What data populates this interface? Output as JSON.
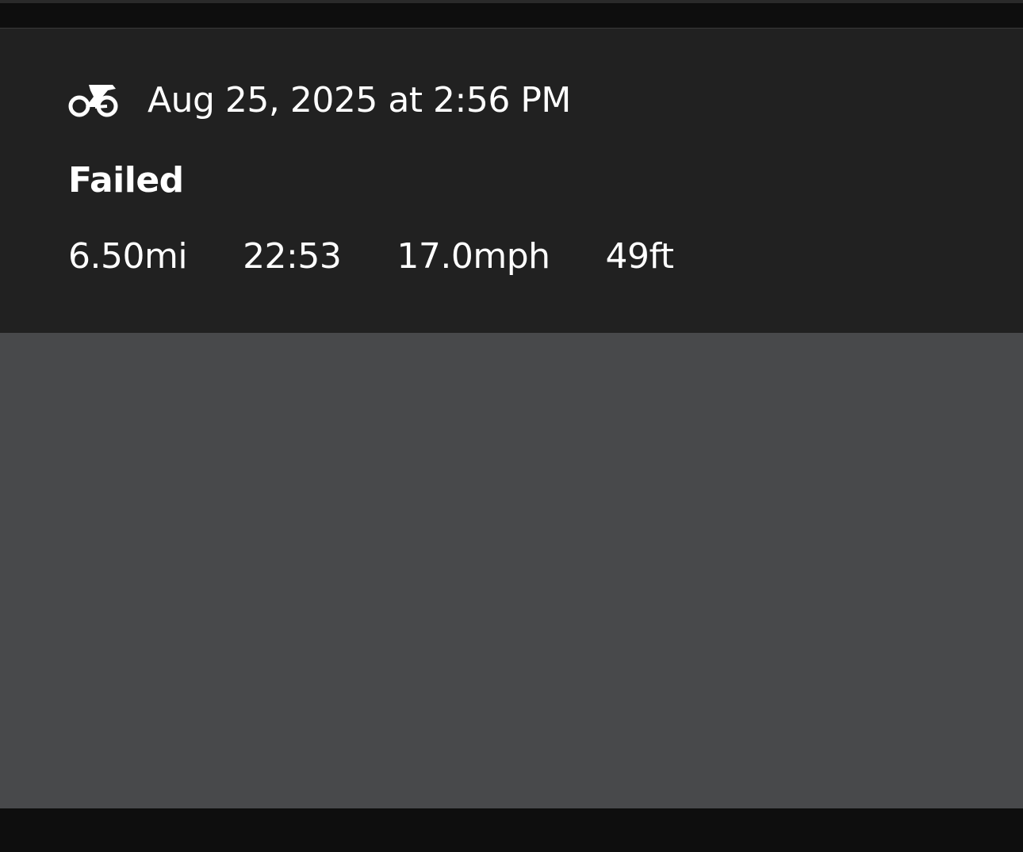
{
  "activity": {
    "type_icon": "bicycle-icon",
    "date": "Aug 25, 2025 at 2:56 PM",
    "status": "Failed",
    "stats": {
      "distance": "6.50mi",
      "duration": "22:53",
      "speed": "17.0mph",
      "elevation": "49ft"
    }
  },
  "colors": {
    "card_background": "#212121",
    "map_placeholder": "#48494b",
    "app_background": "#0e0e0e",
    "text": "#ffffff"
  }
}
